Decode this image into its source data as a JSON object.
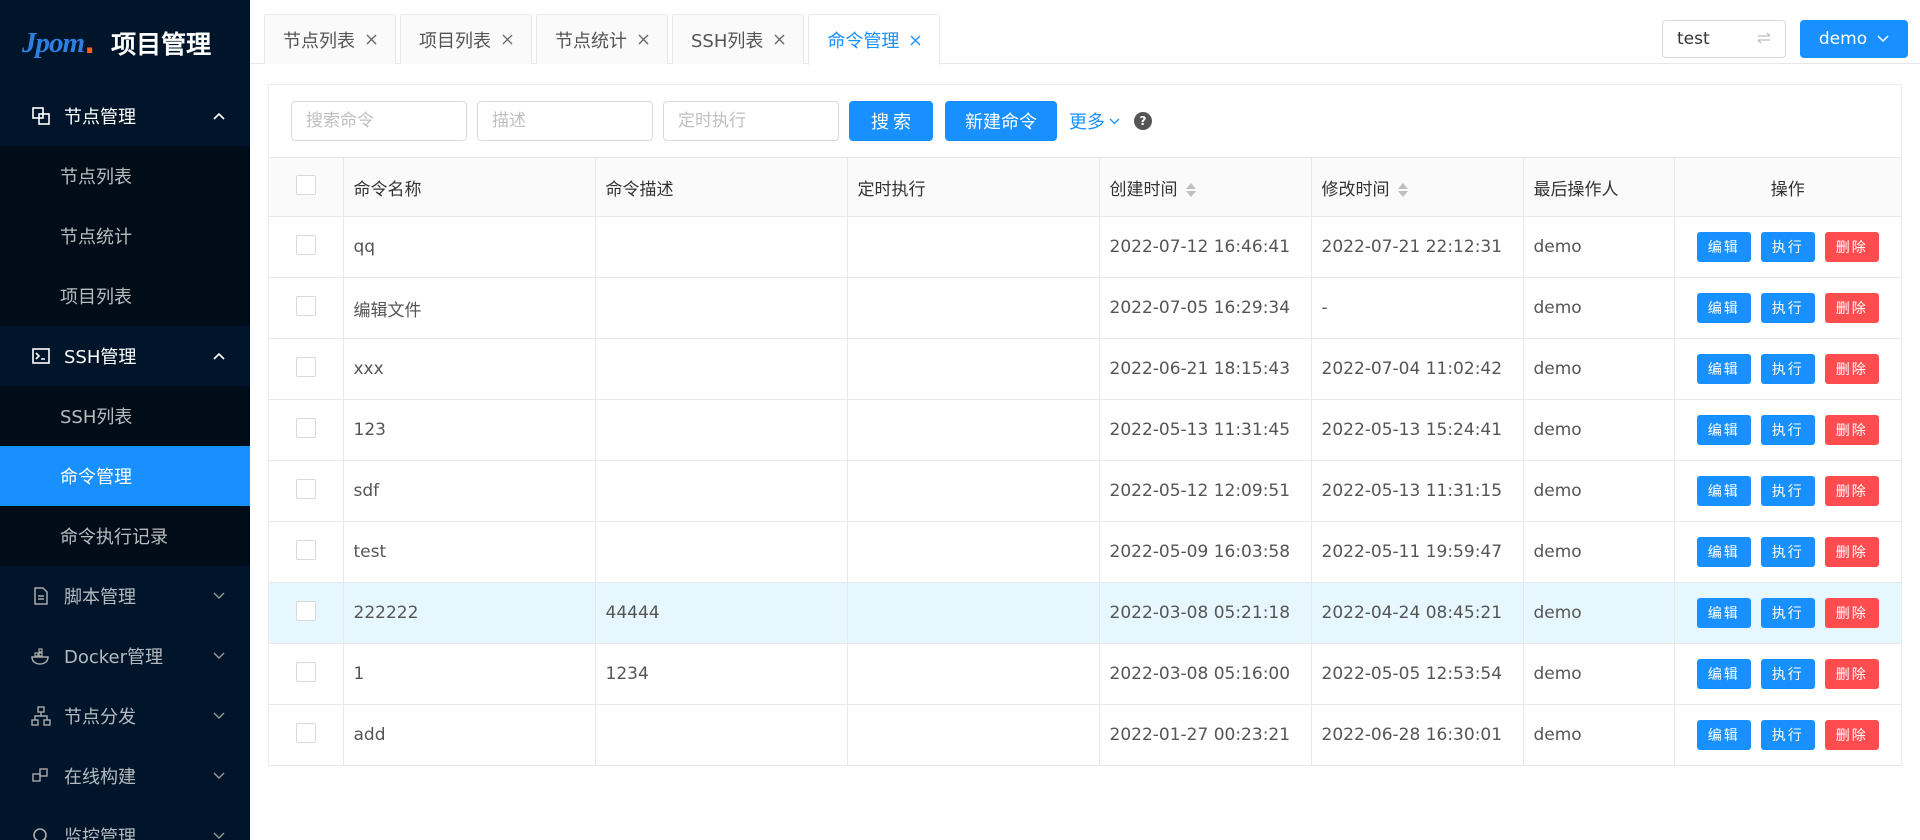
{
  "app": {
    "logo_text": "Jpom",
    "title": "项目管理"
  },
  "sidebar": {
    "groups": [
      {
        "label": "节点管理",
        "icon": "node-icon",
        "expanded": true,
        "items": [
          {
            "label": "节点列表"
          },
          {
            "label": "节点统计"
          },
          {
            "label": "项目列表"
          }
        ]
      },
      {
        "label": "SSH管理",
        "icon": "terminal-icon",
        "expanded": true,
        "items": [
          {
            "label": "SSH列表"
          },
          {
            "label": "命令管理",
            "active": true
          },
          {
            "label": "命令执行记录"
          }
        ]
      },
      {
        "label": "脚本管理",
        "icon": "file-icon",
        "expanded": false
      },
      {
        "label": "Docker管理",
        "icon": "docker-icon",
        "expanded": false
      },
      {
        "label": "节点分发",
        "icon": "cluster-icon",
        "expanded": false
      },
      {
        "label": "在线构建",
        "icon": "build-icon",
        "expanded": false
      },
      {
        "label": "监控管理",
        "icon": "monitor-icon",
        "expanded": false
      }
    ]
  },
  "tabs": [
    {
      "label": "节点列表",
      "active": false
    },
    {
      "label": "项目列表",
      "active": false
    },
    {
      "label": "节点统计",
      "active": false
    },
    {
      "label": "SSH列表",
      "active": false
    },
    {
      "label": "命令管理",
      "active": true
    }
  ],
  "header": {
    "workspace": "test",
    "user": "demo"
  },
  "toolbar": {
    "search_name_placeholder": "搜索命令",
    "desc_placeholder": "描述",
    "cron_placeholder": "定时执行",
    "search_label": "搜索",
    "new_label": "新建命令",
    "more_label": "更多"
  },
  "table": {
    "columns": [
      "命令名称",
      "命令描述",
      "定时执行",
      "创建时间",
      "修改时间",
      "最后操作人",
      "操作"
    ],
    "actions": {
      "edit": "编辑",
      "exec": "执行",
      "delete": "删除"
    },
    "rows": [
      {
        "name": "qq",
        "desc": "",
        "cron": "",
        "created": "2022-07-12 16:46:41",
        "modified": "2022-07-21 22:12:31",
        "user": "demo"
      },
      {
        "name": "编辑文件",
        "desc": "",
        "cron": "",
        "created": "2022-07-05 16:29:34",
        "modified": "-",
        "user": "demo"
      },
      {
        "name": "xxx",
        "desc": "",
        "cron": "",
        "created": "2022-06-21 18:15:43",
        "modified": "2022-07-04 11:02:42",
        "user": "demo"
      },
      {
        "name": "123",
        "desc": "",
        "cron": "",
        "created": "2022-05-13 11:31:45",
        "modified": "2022-05-13 15:24:41",
        "user": "demo"
      },
      {
        "name": "sdf",
        "desc": "",
        "cron": "",
        "created": "2022-05-12 12:09:51",
        "modified": "2022-05-13 11:31:15",
        "user": "demo"
      },
      {
        "name": "test",
        "desc": "",
        "cron": "",
        "created": "2022-05-09 16:03:58",
        "modified": "2022-05-11 19:59:47",
        "user": "demo"
      },
      {
        "name": "222222",
        "desc": "44444",
        "cron": "",
        "created": "2022-03-08 05:21:18",
        "modified": "2022-04-24 08:45:21",
        "user": "demo",
        "highlight": true
      },
      {
        "name": "1",
        "desc": "1234",
        "cron": "",
        "created": "2022-03-08 05:16:00",
        "modified": "2022-05-05 12:53:54",
        "user": "demo"
      },
      {
        "name": "add",
        "desc": "",
        "cron": "",
        "created": "2022-01-27 00:23:21",
        "modified": "2022-06-28 16:30:01",
        "user": "demo"
      }
    ]
  },
  "colors": {
    "primary": "#1890ff",
    "danger": "#ff4d4f",
    "sidebar_bg": "#001529",
    "submenu_bg": "#000c17",
    "row_highlight": "#e6f7ff"
  }
}
